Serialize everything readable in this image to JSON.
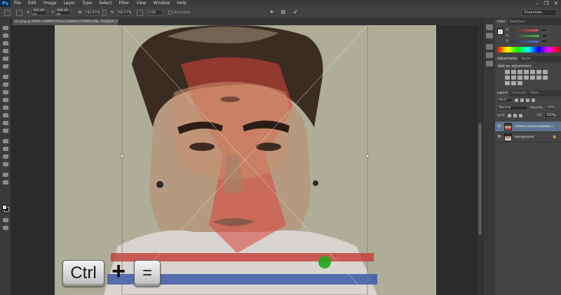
{
  "app": {
    "logo": "Ps"
  },
  "menu": [
    "File",
    "Edit",
    "Image",
    "Layer",
    "Type",
    "Select",
    "Filter",
    "View",
    "Window",
    "Help"
  ],
  "window_controls": [
    "–",
    "❐",
    "✕"
  ],
  "options": {
    "x_label": "X:",
    "x_value": "301.00 px",
    "y_label": "Y:",
    "y_value": "284.00 px",
    "w_label": "W:",
    "w_value": "100.07%",
    "h_label": "H:",
    "h_value": "100.07%",
    "angle_value": "0.00",
    "antialias_label": "Anti-alias",
    "workspace": "Essentials"
  },
  "document": {
    "tab_title": "w1.png @ 200% (cd99f252f6de43b8f8a17f4f8f5c06b, RGB/8#) [Scaled]"
  },
  "panels": {
    "color_tabs": [
      "Color",
      "Swatches"
    ],
    "color_sliders": [
      {
        "label": "R",
        "color": "#e05050"
      },
      {
        "label": "G",
        "color": "#50c050"
      },
      {
        "label": "B",
        "color": "#5070e0"
      }
    ],
    "adjust_tabs": [
      "Adjustments",
      "Styles"
    ],
    "adjust_title": "Add an adjustment",
    "layer_tabs": [
      "Layers",
      "Channels",
      "Paths"
    ],
    "kind_label": "Kind",
    "blend_mode": "Normal",
    "opacity_label": "Opacity:",
    "opacity_value": "50%",
    "lock_label": "Lock:",
    "fill_label": "Fill:",
    "fill_value": "100%",
    "layers": [
      {
        "name": "cd99f252f6de43b8f8a17f4f8f5c06b",
        "selected": true
      },
      {
        "name": "Background",
        "selected": false,
        "lock": "🔒"
      }
    ]
  },
  "keyboard_overlay": {
    "key1": "Ctrl",
    "plus": "+",
    "key2": "="
  }
}
